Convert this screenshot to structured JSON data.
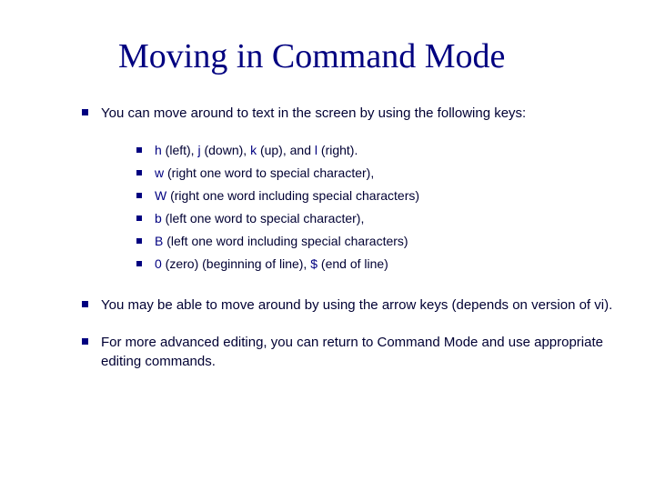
{
  "title": "Moving in Command Mode",
  "para1": "You can move around to text in the screen by using the following keys:",
  "sub": {
    "l1": {
      "k1": "h",
      "t1": " (left), ",
      "k2": "j",
      "t2": " (down), ",
      "k3": "k",
      "t3": " (up), and ",
      "k4": "l",
      "t4": " (right)."
    },
    "l2": {
      "k1": "w",
      "t1": " (right one word to special character),"
    },
    "l3": {
      "k1": "W",
      "t1": " (right one word including special characters)"
    },
    "l4": {
      "k1": "b",
      "t1": " (left one word to special character),"
    },
    "l5": {
      "k1": "B",
      "t1": " (left one word including special characters)"
    },
    "l6": {
      "k1": "0",
      "t1": " (zero) (beginning of line), ",
      "k2": "$",
      "t2": " (end of line)"
    }
  },
  "para2": "You may be able to move around by using the arrow keys (depends on version of vi).",
  "para3": "For more advanced editing, you can return to Command Mode and use appropriate editing commands."
}
